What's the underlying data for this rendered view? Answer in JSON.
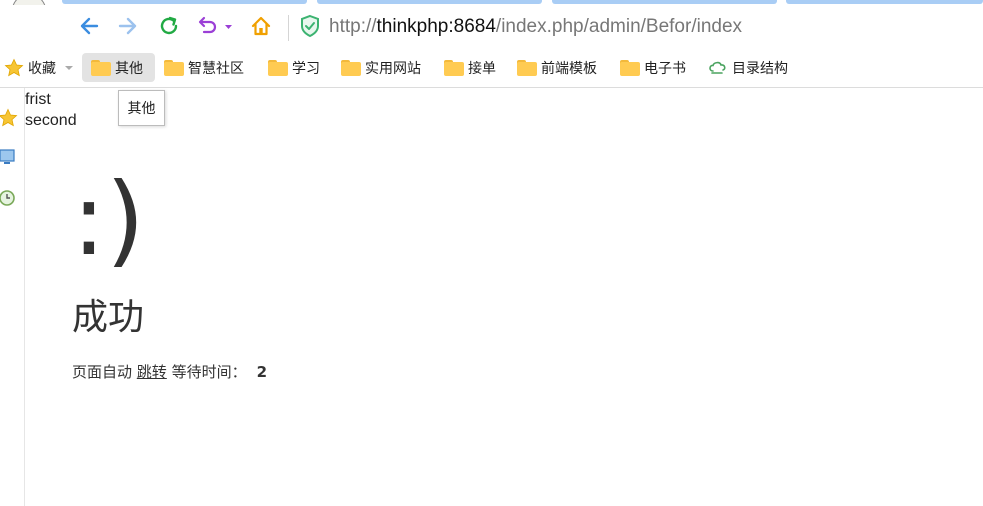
{
  "browser": {
    "url_prefix": "http://",
    "url_host": "thinkphp:8684",
    "url_path": "/index.php/admin/Befor/index"
  },
  "bookmarks": {
    "favorites_label": "收藏",
    "items": [
      {
        "label": "其他"
      },
      {
        "label": "智慧社区"
      },
      {
        "label": "学习"
      },
      {
        "label": "实用网站"
      },
      {
        "label": "接单"
      },
      {
        "label": "前端模板"
      },
      {
        "label": "电子书"
      },
      {
        "label": "目录结构"
      }
    ],
    "tooltip": "其他"
  },
  "page": {
    "debug_line1": "frist",
    "debug_line2": "second",
    "face": ":)",
    "message": "成功",
    "jump_prefix": "页面自动",
    "jump_link": "跳转",
    "wait_label": "等待时间：",
    "wait_seconds": "2"
  },
  "colors": {
    "back_arrow": "#3b8de0",
    "forward_arrow": "#9cc2ee",
    "refresh": "#22aa44",
    "undo": "#9b3fd6",
    "home": "#f0a000",
    "shield": "#3cb371",
    "folder": "#ffcb52"
  }
}
